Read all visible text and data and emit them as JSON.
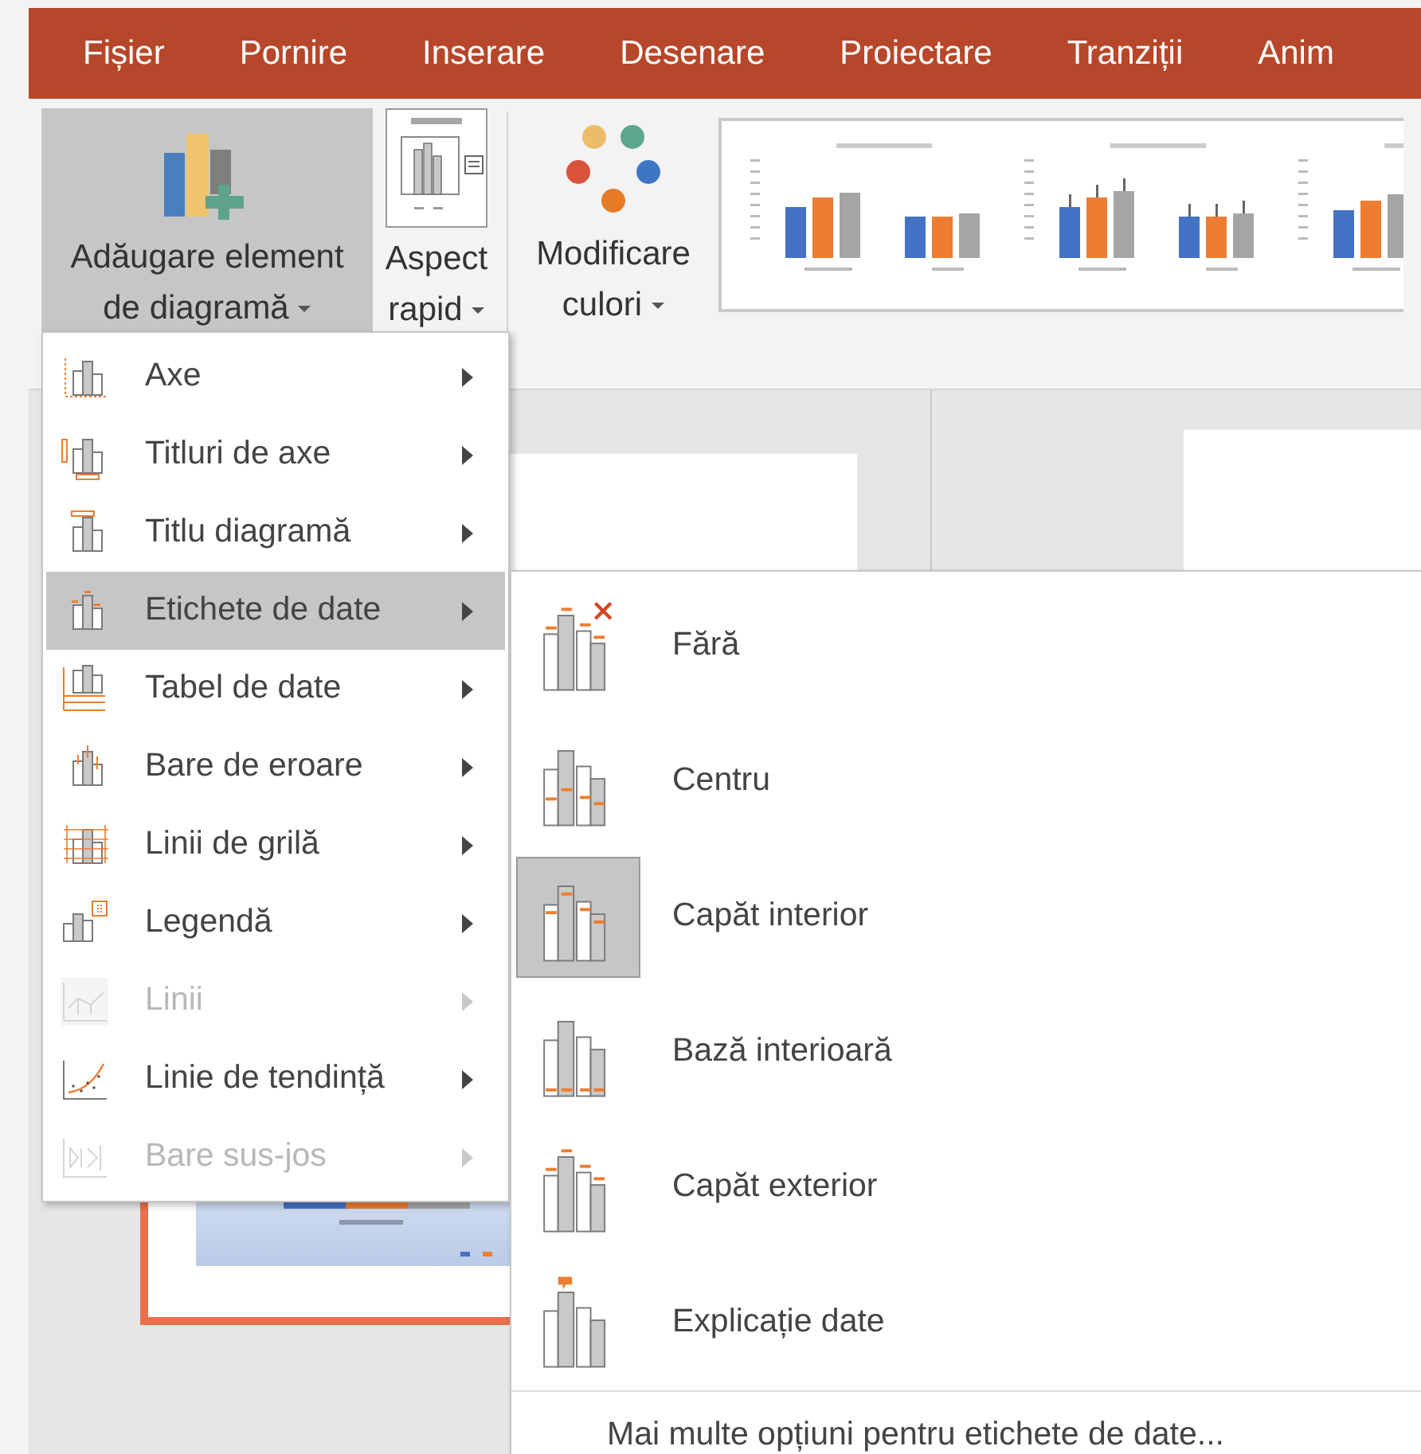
{
  "ribbon_tabs": [
    {
      "label": "Fișier"
    },
    {
      "label": "Pornire"
    },
    {
      "label": "Inserare"
    },
    {
      "label": "Desenare"
    },
    {
      "label": "Proiectare"
    },
    {
      "label": "Tranziții"
    },
    {
      "label": "Anim"
    }
  ],
  "ribbon": {
    "buttons": [
      {
        "kind": "add_element",
        "label_lines": [
          "Adăugare element",
          "de diagramă"
        ],
        "hovered": true
      },
      {
        "kind": "quick_layout",
        "label_lines": [
          "Aspect",
          "rapid"
        ],
        "hovered": false
      },
      {
        "kind": "change_colors",
        "label_lines": [
          "Modificare",
          "culori"
        ],
        "hovered": false
      }
    ]
  },
  "menu": {
    "items": [
      {
        "label": "Axe",
        "selected": false,
        "disabled": false
      },
      {
        "label": "Titluri de axe",
        "selected": false,
        "disabled": false
      },
      {
        "label": "Titlu diagramă",
        "selected": false,
        "disabled": false
      },
      {
        "label": "Etichete de date",
        "selected": true,
        "disabled": false
      },
      {
        "label": "Tabel de date",
        "selected": false,
        "disabled": false
      },
      {
        "label": "Bare de eroare",
        "selected": false,
        "disabled": false
      },
      {
        "label": "Linii de grilă",
        "selected": false,
        "disabled": false
      },
      {
        "label": "Legendă",
        "selected": false,
        "disabled": false
      },
      {
        "label": "Linii",
        "selected": false,
        "disabled": true
      },
      {
        "label": "Linie de tendință",
        "selected": false,
        "disabled": false
      },
      {
        "label": "Bare sus-jos",
        "selected": false,
        "disabled": true
      }
    ]
  },
  "submenu": {
    "items": [
      {
        "label": "Fără",
        "selected": false
      },
      {
        "label": "Centru",
        "selected": false
      },
      {
        "label": "Capăt interior",
        "selected": true
      },
      {
        "label": "Bază interioară",
        "selected": false
      },
      {
        "label": "Capăt exterior",
        "selected": false
      },
      {
        "label": "Explicație date",
        "selected": false
      }
    ],
    "footer": {
      "label": "Mai multe opțiuni pentru etichete de date..."
    }
  }
}
